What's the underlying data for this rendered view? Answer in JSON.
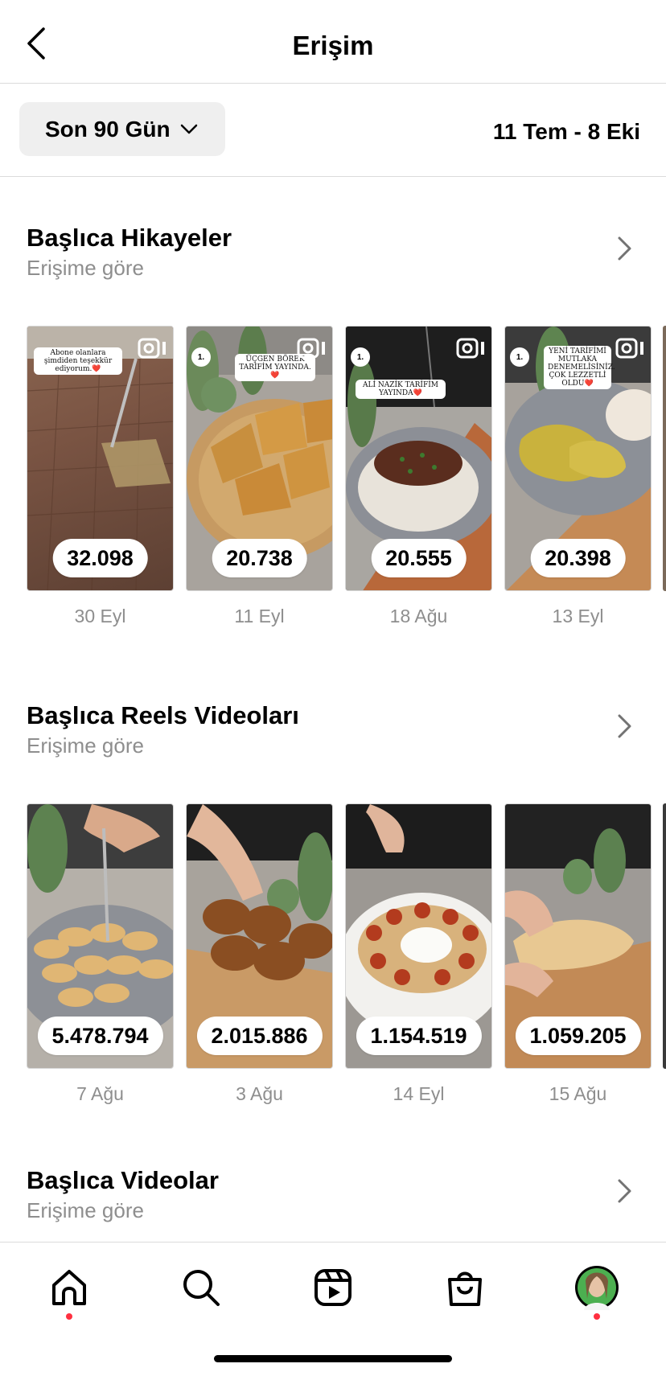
{
  "header": {
    "title": "Erişim",
    "back_icon": "chevron-left-icon"
  },
  "filter": {
    "range_label": "Son 90 Gün",
    "date_range": "11 Tem - 8 Eki"
  },
  "stories": {
    "title": "Başlıca Hikayeler",
    "subtitle": "Erişime göre",
    "items": [
      {
        "value": "32.098",
        "date": "30 Eyl",
        "caption": "Abone olanlara şimdiden teşekkür ediyorum.❤️"
      },
      {
        "value": "20.738",
        "date": "11 Eyl",
        "caption": "ÜÇGEN BÖREK TARİFİM YAYINDA.❤️"
      },
      {
        "value": "20.555",
        "date": "18 Ağu",
        "caption": "ALİ NAZİK TARİFİM YAYINDA❤️"
      },
      {
        "value": "20.398",
        "date": "13 Eyl",
        "caption": "YENİ TARİFİMİ MUTLAKA DENEMELİSİNİZ. ÇOK LEZZETLİ OLDU❤️"
      }
    ]
  },
  "reels": {
    "title": "Başlıca Reels Videoları",
    "subtitle": "Erişime göre",
    "items": [
      {
        "value": "5.478.794",
        "date": "7 Ağu"
      },
      {
        "value": "2.015.886",
        "date": "3 Ağu"
      },
      {
        "value": "1.154.519",
        "date": "14 Eyl"
      },
      {
        "value": "1.059.205",
        "date": "15 Ağu"
      }
    ]
  },
  "videos": {
    "title": "Başlıca Videolar",
    "subtitle": "Erişime göre"
  },
  "nav": {
    "items": [
      "home-icon",
      "search-icon",
      "reels-icon",
      "shop-icon",
      "profile-avatar"
    ],
    "badge_color": "#ff3040"
  }
}
